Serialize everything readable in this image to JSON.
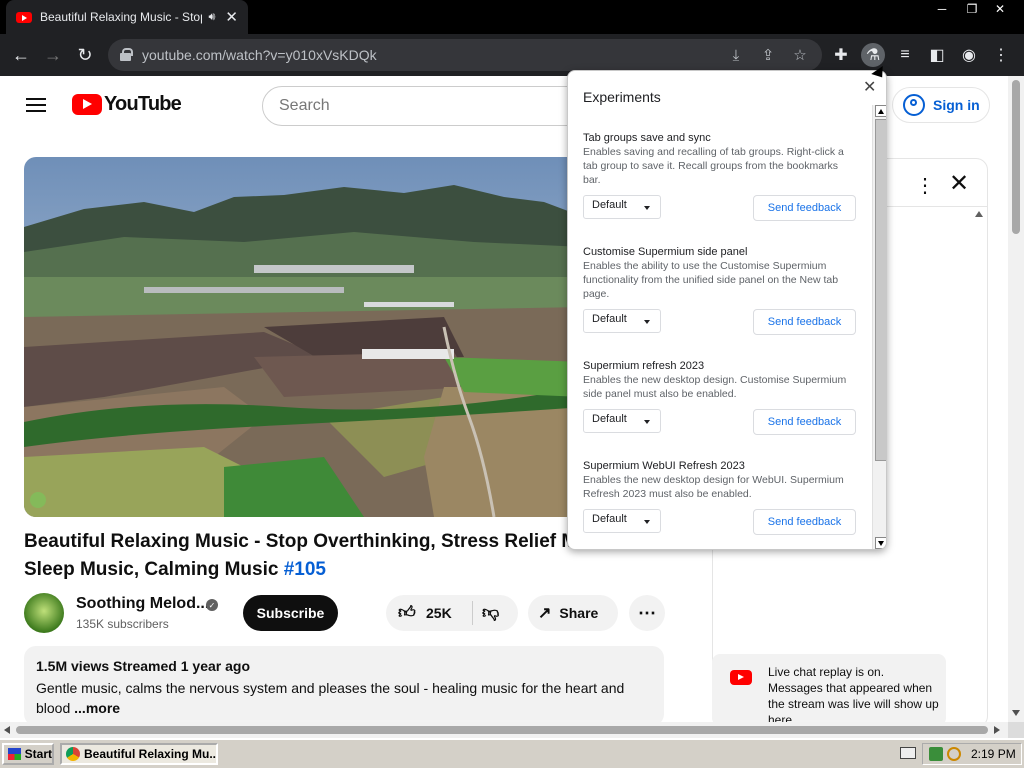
{
  "browser": {
    "tab_title": "Beautiful Relaxing Music - Stop",
    "tab_audio_icon": "speaker-icon",
    "tab_close": "✕",
    "window_min": "─",
    "window_restore": "❐",
    "window_close": "✕",
    "url": "youtube.com/watch?v=y010xVsKDQk"
  },
  "youtube": {
    "logo_text": "YouTube",
    "search_placeholder": "Search",
    "sign_in": "Sign in",
    "video_title": "Beautiful Relaxing Music - Stop Overthinking, Stress Relief M",
    "video_title_line2": "Sleep Music, Calming Music ",
    "hashtag": "#105",
    "channel_name": "Soothing Melod...",
    "subscribers": "135K subscribers",
    "subscribe": "Subscribe",
    "likes": "25K",
    "share": "Share",
    "more": "⋯",
    "desc_meta": "1.5M views  Streamed 1 year ago",
    "desc_line1": "Gentle music, calms the nervous system and pleases the soul - healing music for the heart and",
    "desc_line2": "blood ",
    "desc_more": "...more",
    "chat_replay": "Live chat replay is on. Messages that appeared when the stream was live will show up here."
  },
  "experiments": {
    "title": "Experiments",
    "items": [
      {
        "name": "Tab groups save and sync",
        "desc": "Enables saving and recalling of tab groups. Right-click a tab group to save it. Recall groups from the bookmarks bar.",
        "value": "Default",
        "feedback": "Send feedback"
      },
      {
        "name": "Customise Supermium side panel",
        "desc": "Enables the ability to use the Customise Supermium functionality from the unified side panel on the New tab page.",
        "value": "Default",
        "feedback": "Send feedback"
      },
      {
        "name": "Supermium refresh 2023",
        "desc": "Enables the new desktop design. Customise Supermium side panel must also be enabled.",
        "value": "Default",
        "feedback": "Send feedback"
      },
      {
        "name": "Supermium WebUI Refresh 2023",
        "desc": "Enables the new desktop design for WebUI. Supermium Refresh 2023 must also be enabled.",
        "value": "Default",
        "feedback": "Send feedback"
      }
    ]
  },
  "taskbar": {
    "start": "Start",
    "task_item": "Beautiful Relaxing Mu...",
    "clock": "2:19 PM"
  }
}
